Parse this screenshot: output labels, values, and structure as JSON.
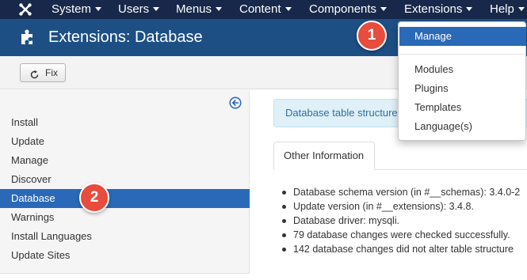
{
  "topnav": {
    "menus": [
      {
        "label": "System"
      },
      {
        "label": "Users"
      },
      {
        "label": "Menus"
      },
      {
        "label": "Content"
      },
      {
        "label": "Components"
      },
      {
        "label": "Extensions"
      },
      {
        "label": "Help"
      }
    ]
  },
  "header": {
    "title": "Extensions: Database"
  },
  "toolbar": {
    "fix_label": "Fix"
  },
  "sidebar": {
    "items": [
      {
        "label": "Install"
      },
      {
        "label": "Update"
      },
      {
        "label": "Manage"
      },
      {
        "label": "Discover"
      },
      {
        "label": "Database"
      },
      {
        "label": "Warnings"
      },
      {
        "label": "Install Languages"
      },
      {
        "label": "Update Sites"
      }
    ]
  },
  "main": {
    "alert": "Database table structure",
    "tab_label": "Other Information",
    "info": [
      "Database schema version (in #__schemas): 3.4.0-2",
      "Update version (in #__extensions): 3.4.8.",
      "Database driver: mysqli.",
      "79 database changes were checked successfully.",
      "142 database changes did not alter table structure"
    ]
  },
  "dropdown": {
    "items": [
      {
        "label": "Manage"
      },
      {
        "label": "Modules"
      },
      {
        "label": "Plugins"
      },
      {
        "label": "Templates"
      },
      {
        "label": "Language(s)"
      }
    ]
  },
  "badges": {
    "step1": "1",
    "step2": "2"
  },
  "colors": {
    "nav_bg": "#17284a",
    "header_bg": "#1d4f85",
    "active_bg": "#2a69b8",
    "badge_red": "#e74c3c",
    "alert_bg": "#dff0f8"
  },
  "icons": {
    "logo": "joomla-logo-icon",
    "header": "puzzle-icon",
    "fix": "refresh-icon",
    "sidebar": "collapse-left-icon"
  }
}
